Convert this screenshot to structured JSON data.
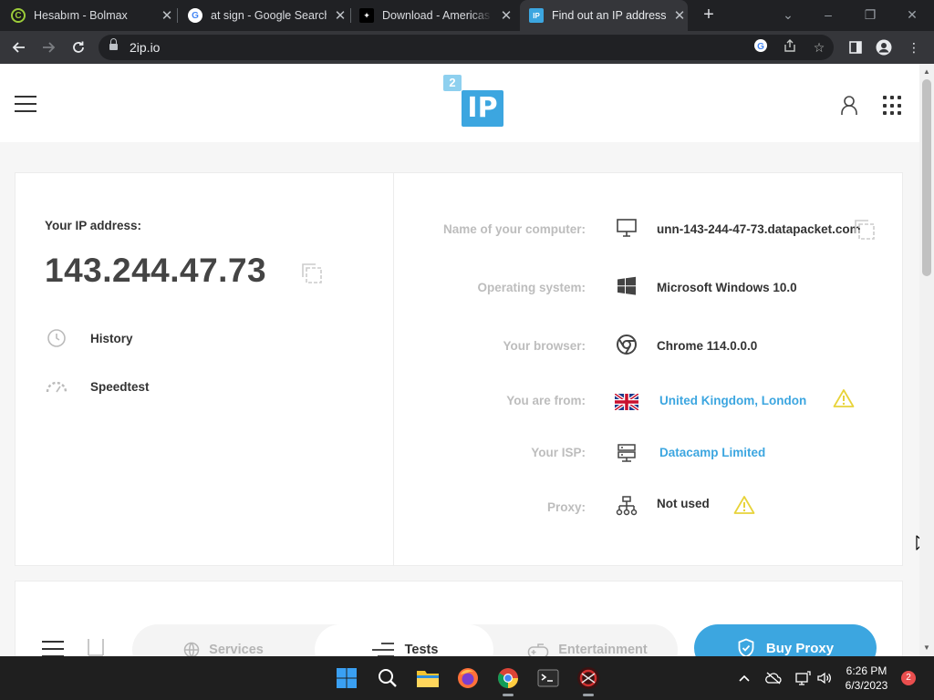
{
  "browser": {
    "tabs": [
      {
        "label": "Hesabım - Bolmax",
        "icon": "bolmax-icon",
        "active": false
      },
      {
        "label": "at sign - Google Search",
        "icon": "google-icon",
        "active": false
      },
      {
        "label": "Download - Americas Cardroom",
        "icon": "acr-icon",
        "active": false
      },
      {
        "label": "Find out an IP address",
        "icon": "2ip-icon",
        "active": true
      }
    ],
    "url": "2ip.io"
  },
  "page": {
    "ip_title": "Your IP address:",
    "ip_value": "143.244.47.73",
    "left_links": {
      "history": "History",
      "speedtest": "Speedtest"
    },
    "details": {
      "computer": {
        "label": "Name of your computer:",
        "value": "unn-143-244-47-73.datapacket.com"
      },
      "os": {
        "label": "Operating system:",
        "value": "Microsoft Windows 10.0"
      },
      "browser": {
        "label": "Your browser:",
        "value": "Chrome 114.0.0.0"
      },
      "location": {
        "label": "You are from:",
        "value": "United Kingdom, London"
      },
      "isp": {
        "label": "Your ISP:",
        "value": "Datacamp Limited"
      },
      "proxy": {
        "label": "Proxy:",
        "value": "Not used"
      }
    },
    "nav": {
      "services": "Services",
      "tests": "Tests",
      "entertainment": "Entertainment",
      "buy_proxy": "Buy Proxy"
    },
    "colors": {
      "accent": "#3ca6e0",
      "warning": "#e8d33a"
    }
  },
  "logo": {
    "small": "2",
    "big": "IP"
  },
  "taskbar": {
    "time": "6:26 PM",
    "date": "6/3/2023",
    "notifications": "2"
  }
}
